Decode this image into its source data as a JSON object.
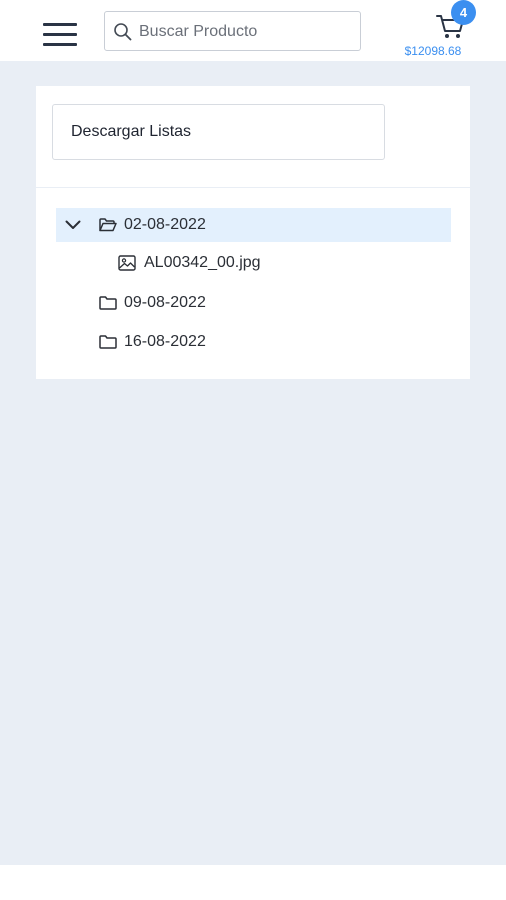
{
  "header": {
    "search": {
      "placeholder": "Buscar Producto",
      "value": ""
    },
    "cart": {
      "count": "4",
      "total": "$12098.68"
    }
  },
  "main": {
    "download_button": "Descargar Listas",
    "tree": [
      {
        "label": "02-08-2022",
        "type": "folder",
        "expanded": true,
        "selected": true,
        "children": [
          {
            "label": "AL00342_00.jpg",
            "type": "image"
          }
        ]
      },
      {
        "label": "09-08-2022",
        "type": "folder",
        "expanded": false
      },
      {
        "label": "16-08-2022",
        "type": "folder",
        "expanded": false
      }
    ]
  },
  "colors": {
    "accent": "#3b8ff0",
    "background": "#e9eef5",
    "selected_row": "#e3f0fd"
  },
  "icons": [
    "hamburger-menu-icon",
    "search-icon",
    "cart-icon",
    "chevron-down-icon",
    "folder-open-icon",
    "image-icon",
    "folder-icon"
  ]
}
